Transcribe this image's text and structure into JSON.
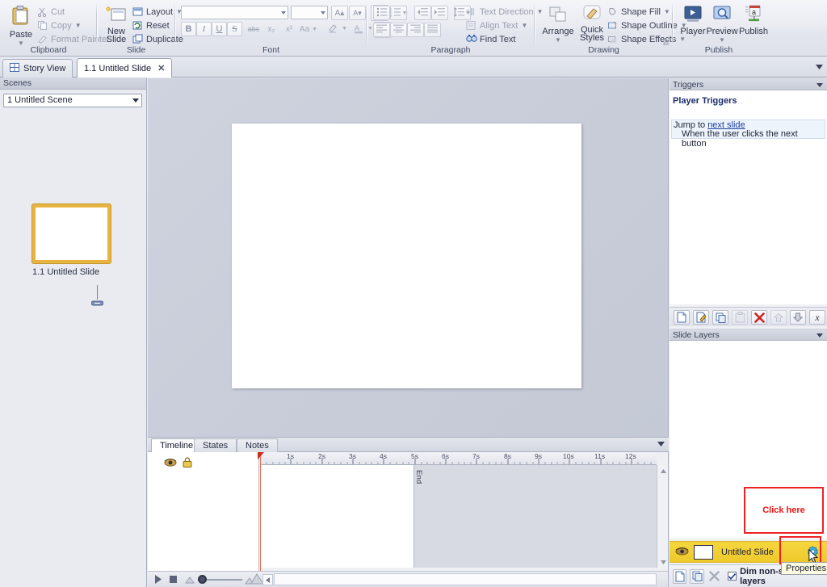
{
  "ribbon": {
    "groups": [
      {
        "name": "Clipboard",
        "label": "Clipboard",
        "paste": "Paste",
        "items": [
          {
            "label": "Cut",
            "icon": "scissors-icon",
            "disabled": true
          },
          {
            "label": "Copy",
            "icon": "copy-icon",
            "disabled": true,
            "caret": true
          },
          {
            "label": "Format Painter",
            "icon": "format-painter-icon",
            "disabled": true
          }
        ]
      },
      {
        "name": "Slide",
        "label": "Slide",
        "newslide": "New\nSlide",
        "newslide_line1": "New",
        "newslide_line2": "Slide",
        "items": [
          {
            "label": "Layout",
            "icon": "layout-icon",
            "caret": true
          },
          {
            "label": "Reset",
            "icon": "reset-icon"
          },
          {
            "label": "Duplicate",
            "icon": "duplicate-icon"
          }
        ]
      },
      {
        "name": "Font",
        "label": "Font",
        "font_name_value": "",
        "font_size_value": "",
        "buttons": [
          "B",
          "I",
          "U",
          "S",
          "abc",
          "x₂",
          "x²",
          "Aa"
        ]
      },
      {
        "name": "Paragraph",
        "label": "Paragraph",
        "items": [
          {
            "label": "Text Direction",
            "icon": "text-direction-icon",
            "disabled": true,
            "caret": true
          },
          {
            "label": "Align Text",
            "icon": "align-text-icon",
            "disabled": true,
            "caret": true
          },
          {
            "label": "Find Text",
            "icon": "find-text-icon",
            "disabled": false
          }
        ]
      },
      {
        "name": "Drawing",
        "label": "Drawing",
        "arrange": "Arrange",
        "quickstyles_line1": "Quick",
        "quickstyles_line2": "Styles",
        "items": [
          {
            "label": "Shape Fill",
            "icon": "shape-fill-icon",
            "caret": true
          },
          {
            "label": "Shape Outline",
            "icon": "shape-outline-icon",
            "caret": true
          },
          {
            "label": "Shape Effects",
            "icon": "shape-effects-icon",
            "caret": true
          }
        ]
      },
      {
        "name": "Publish",
        "label": "Publish",
        "player": "Player",
        "preview": "Preview",
        "publish": "Publish"
      }
    ]
  },
  "tabs": {
    "items": [
      {
        "label": "Story View",
        "active": false,
        "icon": "story-view-icon"
      },
      {
        "label": "1.1 Untitled Slide",
        "active": true,
        "close": "✕"
      }
    ],
    "overflow_icon": "chevron-down-icon"
  },
  "scenes": {
    "header": "Scenes",
    "selected": "1 Untitled Scene",
    "slide_label": "1.1 Untitled Slide"
  },
  "timeline": {
    "tabs": [
      "Timeline",
      "States",
      "Notes"
    ],
    "active_tab": "Timeline",
    "ruler_ticks": [
      "1s",
      "2s",
      "3s",
      "4s",
      "5s",
      "6s",
      "7s",
      "8s",
      "9s",
      "10s",
      "11s",
      "12s"
    ],
    "end_label": "End",
    "play_icon": "play-icon",
    "stop_icon": "stop-icon",
    "zoom_out_icon": "zoom-out-icon",
    "zoom_in_icon": "zoom-in-icon",
    "eye_icon": "eye-icon",
    "lock_icon": "lock-icon",
    "scroll_left_icon": "scroll-left-icon"
  },
  "triggers": {
    "header": "Triggers",
    "title": "Player Triggers",
    "jump_prefix": "Jump to ",
    "jump_link": "next slide",
    "condition": "When the user clicks the next button",
    "tools": [
      {
        "name": "new-trigger-button",
        "icon": "new-page-icon"
      },
      {
        "name": "edit-trigger-button",
        "icon": "edit-pencil-icon"
      },
      {
        "name": "copy-trigger-button",
        "icon": "copy-icon"
      },
      {
        "name": "paste-trigger-button",
        "icon": "paste-icon",
        "disabled": true
      },
      {
        "name": "delete-trigger-button",
        "icon": "delete-x-icon"
      },
      {
        "name": "move-up-button",
        "icon": "arrow-up-icon",
        "disabled": true
      },
      {
        "name": "move-down-button",
        "icon": "arrow-down-icon"
      },
      {
        "name": "variable-button",
        "icon": "variable-x-icon"
      }
    ]
  },
  "slide_layers": {
    "header": "Slide Layers",
    "row_name": "Untitled Slide",
    "eye_icon": "eye-icon",
    "gear_icon": "gear-properties-icon",
    "dim_label": "Dim non-selected layers",
    "dim_checked": true,
    "new_layer_icon": "new-page-icon",
    "duplicate_layer_icon": "duplicate-icon",
    "delete_layer_icon": "delete-x-icon"
  },
  "annotations": {
    "callout_text": "Click here",
    "tooltip_text": "Properties",
    "highlight_color": "#ee2222",
    "callout_text_color": "#ee1111"
  },
  "colors": {
    "selection_gold": "#e8b441",
    "layer_row_gold": "#f6d63f",
    "link_blue": "#1a3fa0",
    "trigger_title_blue": "#1b2d6b"
  }
}
